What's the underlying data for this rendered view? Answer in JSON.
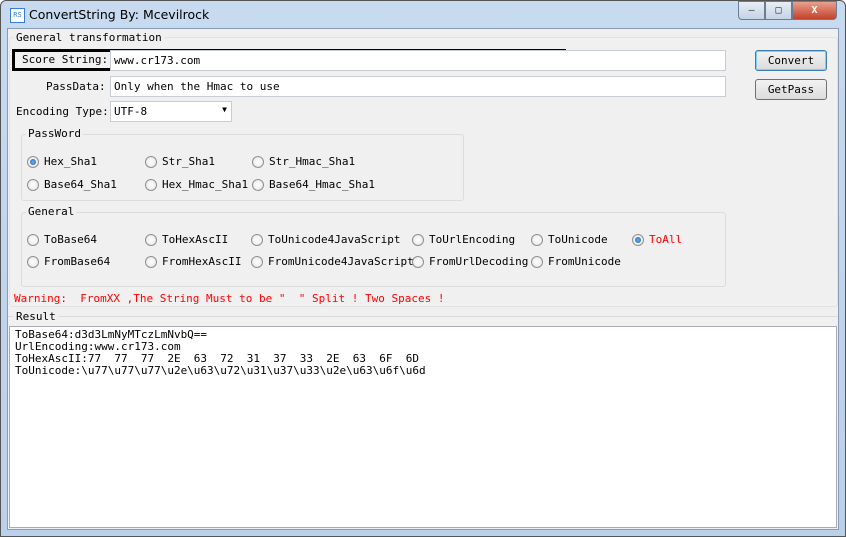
{
  "window": {
    "title": "ConvertString By: Mcevilrock",
    "icon_text": "RS",
    "minimize": "—",
    "maximize": "□",
    "close": "X"
  },
  "group_title": "General transformation",
  "score_label": "Score String:",
  "score_value": "www.cr173.com",
  "passdata_label": "PassData:",
  "passdata_value": "Only when the Hmac to use",
  "encoding_label": "Encoding Type:",
  "encoding_value": "UTF-8",
  "buttons": {
    "convert": "Convert",
    "getpass": "GetPass"
  },
  "password_group": {
    "title": "PassWord",
    "options": [
      "Hex_Sha1",
      "Str_Sha1",
      "Str_Hmac_Sha1",
      "Base64_Sha1",
      "Hex_Hmac_Sha1",
      "Base64_Hmac_Sha1"
    ],
    "selected": "Hex_Sha1"
  },
  "general_group": {
    "title": "General",
    "options": [
      "ToBase64",
      "ToHexAscII",
      "ToUnicode4JavaScript",
      "ToUrlEncoding",
      "ToUnicode",
      "ToAll",
      "FromBase64",
      "FromHexAscII",
      "FromUnicode4JavaScript",
      "FromUrlDecoding",
      "FromUnicode"
    ],
    "selected": "ToAll"
  },
  "warning": "Warning:  FromXX ,The String Must to be \"  \" Split ! Two Spaces !",
  "result_title": "Result",
  "result_text": "ToBase64:d3d3LmNyMTczLmNvbQ==\nUrlEncoding:www.cr173.com\nToHexAscII:77  77  77  2E  63  72  31  37  33  2E  63  6F  6D\nToUnicode:\\u77\\u77\\u77\\u2e\\u63\\u72\\u31\\u37\\u33\\u2e\\u63\\u6f\\u6d",
  "colors": {
    "warning": "#ff0000",
    "selected_radio_label": "#ff0000"
  }
}
